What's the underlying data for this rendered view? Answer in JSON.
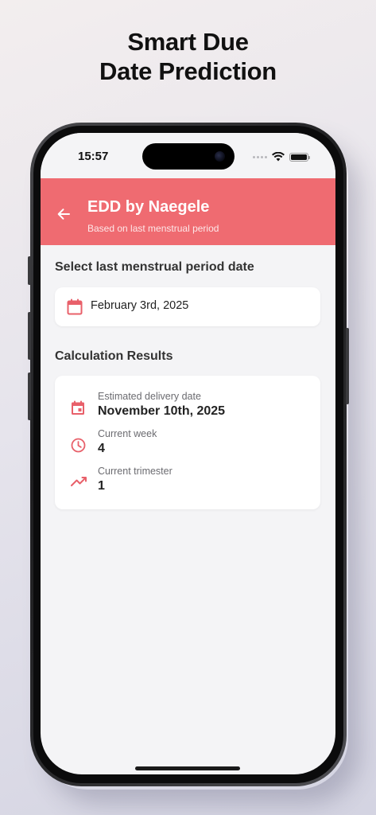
{
  "promo": {
    "line1": "Smart Due",
    "line2": "Date Prediction"
  },
  "status_bar": {
    "time": "15:57",
    "icons": [
      "signal-dots-icon",
      "wifi-icon",
      "battery-icon"
    ]
  },
  "app_bar": {
    "title": "EDD by Naegele",
    "subtitle": "Based on last menstrual period",
    "back_icon": "arrow-left-icon",
    "color": "#ef6b71"
  },
  "lmp": {
    "label": "Select last menstrual period date",
    "value": "February 3rd, 2025",
    "icon": "calendar-icon"
  },
  "results": {
    "label": "Calculation Results",
    "items": [
      {
        "icon": "event-icon",
        "label": "Estimated delivery date",
        "value": "November 10th, 2025"
      },
      {
        "icon": "clock-icon",
        "label": "Current week",
        "value": "4"
      },
      {
        "icon": "trending-up-icon",
        "label": "Current trimester",
        "value": "1"
      }
    ]
  },
  "accent_color": "#e8606a"
}
